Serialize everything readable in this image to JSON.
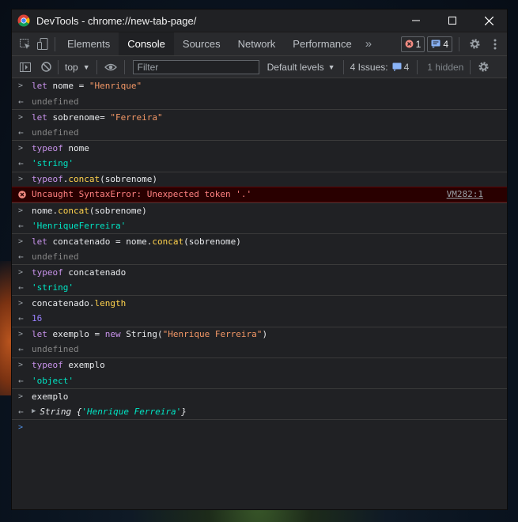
{
  "titlebar": {
    "title": "DevTools - chrome://new-tab-page/"
  },
  "tabs": [
    {
      "label": "Elements"
    },
    {
      "label": "Console"
    },
    {
      "label": "Sources"
    },
    {
      "label": "Network"
    },
    {
      "label": "Performance"
    }
  ],
  "tab_active": "Console",
  "badges": {
    "errors": "1",
    "messages": "4"
  },
  "toolbar": {
    "context": "top",
    "filter_placeholder": "Filter",
    "levels": "Default levels",
    "issues_label": "4 Issues:",
    "issues_count": "4",
    "hidden": "1 hidden"
  },
  "console": [
    {
      "type": "input",
      "parts": [
        [
          "kw",
          "let"
        ],
        [
          "p",
          " nome = "
        ],
        [
          "str",
          "\"Henrique\""
        ]
      ]
    },
    {
      "type": "output",
      "parts": [
        [
          "undef",
          "undefined"
        ]
      ]
    },
    {
      "type": "input",
      "parts": [
        [
          "kw",
          "let"
        ],
        [
          "p",
          " sobrenome= "
        ],
        [
          "str",
          "\"Ferreira\""
        ]
      ]
    },
    {
      "type": "output",
      "parts": [
        [
          "undef",
          "undefined"
        ]
      ]
    },
    {
      "type": "input",
      "parts": [
        [
          "kw",
          "typeof"
        ],
        [
          "p",
          " nome"
        ]
      ]
    },
    {
      "type": "output",
      "parts": [
        [
          "rs",
          "'string'"
        ]
      ]
    },
    {
      "type": "input",
      "parts": [
        [
          "kw",
          "typeof"
        ],
        [
          "p",
          "."
        ],
        [
          "fn",
          "concat"
        ],
        [
          "p",
          "(sobrenome)"
        ]
      ]
    },
    {
      "type": "error",
      "text": "Uncaught SyntaxError: Unexpected token '.'",
      "link": "VM282:1"
    },
    {
      "type": "input",
      "parts": [
        [
          "p",
          "nome."
        ],
        [
          "fn",
          "concat"
        ],
        [
          "p",
          "(sobrenome)"
        ]
      ]
    },
    {
      "type": "output",
      "parts": [
        [
          "rs",
          "'HenriqueFerreira'"
        ]
      ]
    },
    {
      "type": "input",
      "parts": [
        [
          "kw",
          "let"
        ],
        [
          "p",
          " concatenado = nome."
        ],
        [
          "fn",
          "concat"
        ],
        [
          "p",
          "(sobrenome)"
        ]
      ]
    },
    {
      "type": "output",
      "parts": [
        [
          "undef",
          "undefined"
        ]
      ]
    },
    {
      "type": "input",
      "parts": [
        [
          "kw",
          "typeof"
        ],
        [
          "p",
          " concatenado"
        ]
      ]
    },
    {
      "type": "output",
      "parts": [
        [
          "rs",
          "'string'"
        ]
      ]
    },
    {
      "type": "input",
      "parts": [
        [
          "p",
          "concatenado."
        ],
        [
          "fn",
          "length"
        ]
      ]
    },
    {
      "type": "output",
      "parts": [
        [
          "num",
          "16"
        ]
      ]
    },
    {
      "type": "input",
      "parts": [
        [
          "kw",
          "let"
        ],
        [
          "p",
          " exemplo = "
        ],
        [
          "kw",
          "new"
        ],
        [
          "p",
          " String("
        ],
        [
          "str",
          "\"Henrique Ferreira\""
        ],
        [
          "p",
          ")"
        ]
      ]
    },
    {
      "type": "output",
      "parts": [
        [
          "undef",
          "undefined"
        ]
      ]
    },
    {
      "type": "input",
      "parts": [
        [
          "kw",
          "typeof"
        ],
        [
          "p",
          " exemplo"
        ]
      ]
    },
    {
      "type": "output",
      "parts": [
        [
          "rs",
          "'object'"
        ]
      ]
    },
    {
      "type": "input",
      "parts": [
        [
          "p",
          "exemplo"
        ]
      ]
    },
    {
      "type": "object",
      "label": "String",
      "value": "'Henrique Ferreira'"
    }
  ],
  "colors": {
    "accent": "#8ab4f8",
    "error_bg": "#290000",
    "error_text": "#ff8080"
  }
}
